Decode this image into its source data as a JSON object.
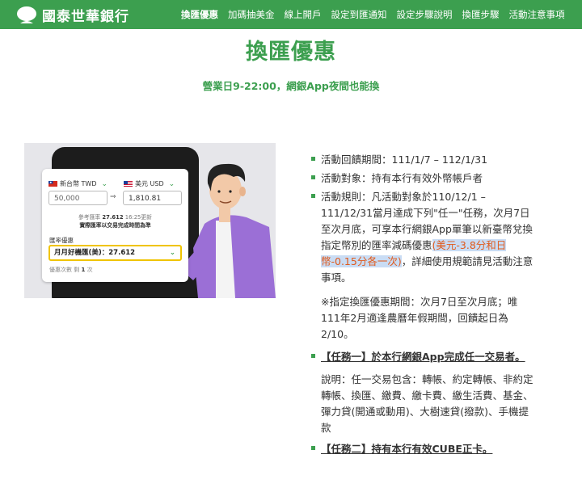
{
  "header": {
    "logo_text": "國泰世華銀行",
    "nav": [
      "換匯優惠",
      "加碼抽美金",
      "線上開戶",
      "設定到匯通知",
      "設定步驟說明",
      "換匯步驟",
      "活動注意事項"
    ]
  },
  "page": {
    "title": "換匯優惠",
    "hours": "營業日9-22:00，網銀App夜間也能換"
  },
  "illustration": {
    "from_currency": "新台幣 TWD",
    "to_currency": "美元 USD",
    "from_amount": "50,000",
    "to_amount": "1,810.81",
    "ref_label": "參考匯率",
    "ref_rate": "27.612",
    "ref_time": "16:25更新",
    "real_note": "實際匯率以交易完成時間為準",
    "promo_label": "匯率優惠",
    "promo_value": "月月好機匯(美)：27.612",
    "times_text": "優惠次數 剩",
    "times_count": "1",
    "times_unit": "次"
  },
  "content": {
    "period": "活動回饋期間：111/1/7 – 112/1/31",
    "target": "活動對象：持有本行有效外幣帳戶者",
    "rule_pre": "活動規則：凡活動對象於110/12/1 – 111/12/31當月達成下列\"任一\"任務，次月7日至次月底，可享本行網銀App單筆以新臺幣兌換指定幣別的匯率減碼優惠",
    "rule_highlight": "(美元-3.8分和日幣-0.15分各一次)",
    "rule_post": "，詳細使用規範請見活動注意事項。",
    "note": "※指定換匯優惠期間：次月7日至次月底；唯111年2月適逢農曆年假期間，回饋起日為2/10。",
    "task1": "【任務一】於本行網銀App完成任一交易者。",
    "task1_desc": "說明：任一交易包含：轉帳、約定轉帳、非約定轉帳、換匯、繳費、繳卡費、繳生活費、基金、彈力貸(開通或動用)、大樹速貸(撥款)、手機提款",
    "task2": "【任務二】持有本行有效CUBE正卡。"
  },
  "colors": {
    "brand_green": "#3c9f4f",
    "highlight_text": "#e05a1c",
    "highlight_bg": "#c9dcf4",
    "promo_border": "#f0c400",
    "shirt_purple": "#9b6fd6"
  },
  "icons": [
    "tree-logo-icon",
    "taiwan-flag-icon",
    "us-flag-icon",
    "chevron-down-icon",
    "arrow-right-icon"
  ]
}
